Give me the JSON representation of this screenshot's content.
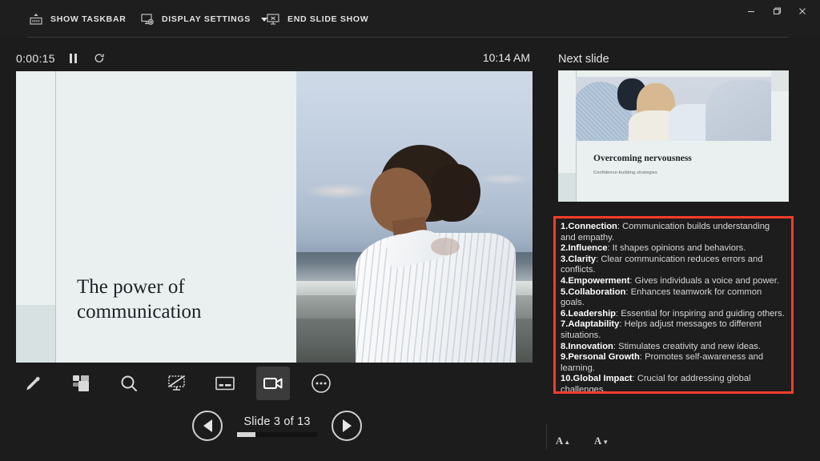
{
  "topbar": {
    "show_taskbar": "SHOW TASKBAR",
    "display_settings": "DISPLAY SETTINGS",
    "end_slide_show": "END SLIDE SHOW",
    "icons": {
      "show_taskbar": "taskbar-icon",
      "display_settings": "display-settings-icon",
      "end_slide_show": "end-show-icon"
    }
  },
  "window_controls": {
    "minimize": "minimize-icon",
    "restore": "restore-icon",
    "close": "close-icon"
  },
  "timer": {
    "elapsed": "0:00:15",
    "pause_icon": "pause-icon",
    "restart_icon": "restart-icon"
  },
  "clock": {
    "time": "10:14 AM"
  },
  "current_slide": {
    "title": "The power of communication",
    "title_line1": "The power of",
    "title_line2": "communication",
    "image_alt": "woman-on-beach-photo"
  },
  "toolbar": {
    "items": [
      {
        "name": "pen-icon",
        "label": "Pen",
        "active": false
      },
      {
        "name": "all-slides-icon",
        "label": "See all slides",
        "active": false
      },
      {
        "name": "zoom-icon",
        "label": "Zoom into the slide",
        "active": false
      },
      {
        "name": "black-screen-icon",
        "label": "Black or unblack slide show",
        "active": false
      },
      {
        "name": "subtitles-icon",
        "label": "Toggle subtitles",
        "active": false
      },
      {
        "name": "camera-icon",
        "label": "Camera",
        "active": true
      },
      {
        "name": "more-options-icon",
        "label": "More slide show options",
        "active": false
      }
    ]
  },
  "navigation": {
    "previous_icon": "previous-slide-icon",
    "next_icon": "next-slide-icon",
    "counter": "Slide 3 of 13",
    "current": 3,
    "total": 13,
    "progress_percent": 23
  },
  "right_panel": {
    "next_slide_label": "Next slide",
    "next_slide": {
      "title": "Overcoming nervousness",
      "subtitle": "Confidence-building strategies",
      "image_alt": "group-of-people-photo"
    },
    "notes_border_color": "#fa3c2d",
    "notes": [
      {
        "num": "1.",
        "term": "Connection",
        "text": ": Communication builds understanding and empathy."
      },
      {
        "num": "2.",
        "term": "Influence",
        "text": ": It shapes opinions and behaviors."
      },
      {
        "num": "3.",
        "term": "Clarity",
        "text": ": Clear communication reduces errors and conflicts."
      },
      {
        "num": "4.",
        "term": "Empowerment",
        "text": ": Gives individuals a voice and power."
      },
      {
        "num": "5.",
        "term": "Collaboration",
        "text": ": Enhances teamwork for common goals."
      },
      {
        "num": "6.",
        "term": "Leadership",
        "text": ": Essential for inspiring and guiding others."
      },
      {
        "num": "7.",
        "term": "Adaptability",
        "text": ": Helps adjust messages to different situations."
      },
      {
        "num": "8.",
        "term": "Innovation",
        "text": ": Stimulates creativity and new ideas."
      },
      {
        "num": "9.",
        "term": "Personal Growth",
        "text": ": Promotes self-awareness and learning."
      },
      {
        "num": "10.",
        "term": "Global Impact",
        "text": ": Crucial for addressing global challenges."
      }
    ],
    "font_buttons": {
      "increase": "A",
      "increase_icon": "increase-font-size-icon",
      "decrease": "A",
      "decrease_icon": "decrease-font-size-icon"
    }
  }
}
